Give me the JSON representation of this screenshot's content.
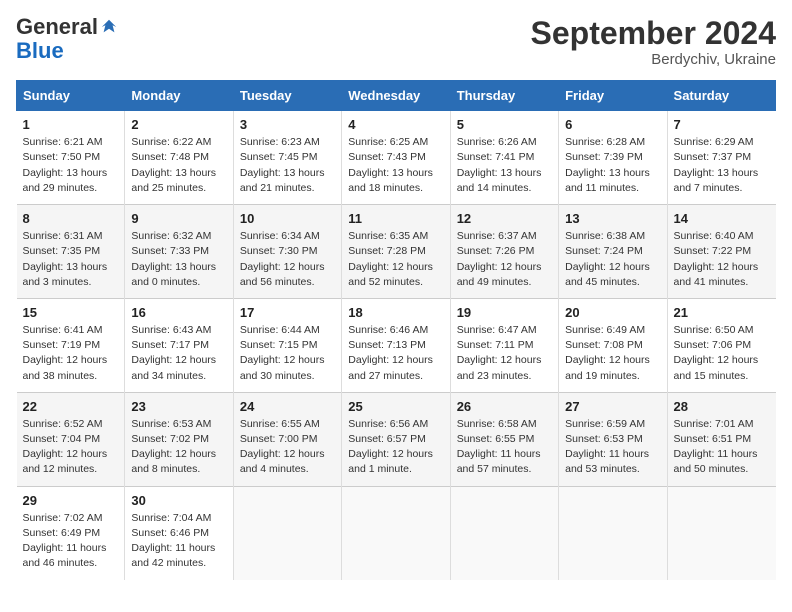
{
  "logo": {
    "general": "General",
    "blue": "Blue"
  },
  "header": {
    "title": "September 2024",
    "subtitle": "Berdychiv, Ukraine"
  },
  "days_of_week": [
    "Sunday",
    "Monday",
    "Tuesday",
    "Wednesday",
    "Thursday",
    "Friday",
    "Saturday"
  ],
  "weeks": [
    [
      {
        "num": "1",
        "rise": "Sunrise: 6:21 AM",
        "set": "Sunset: 7:50 PM",
        "daylight": "Daylight: 13 hours and 29 minutes."
      },
      {
        "num": "2",
        "rise": "Sunrise: 6:22 AM",
        "set": "Sunset: 7:48 PM",
        "daylight": "Daylight: 13 hours and 25 minutes."
      },
      {
        "num": "3",
        "rise": "Sunrise: 6:23 AM",
        "set": "Sunset: 7:45 PM",
        "daylight": "Daylight: 13 hours and 21 minutes."
      },
      {
        "num": "4",
        "rise": "Sunrise: 6:25 AM",
        "set": "Sunset: 7:43 PM",
        "daylight": "Daylight: 13 hours and 18 minutes."
      },
      {
        "num": "5",
        "rise": "Sunrise: 6:26 AM",
        "set": "Sunset: 7:41 PM",
        "daylight": "Daylight: 13 hours and 14 minutes."
      },
      {
        "num": "6",
        "rise": "Sunrise: 6:28 AM",
        "set": "Sunset: 7:39 PM",
        "daylight": "Daylight: 13 hours and 11 minutes."
      },
      {
        "num": "7",
        "rise": "Sunrise: 6:29 AM",
        "set": "Sunset: 7:37 PM",
        "daylight": "Daylight: 13 hours and 7 minutes."
      }
    ],
    [
      {
        "num": "8",
        "rise": "Sunrise: 6:31 AM",
        "set": "Sunset: 7:35 PM",
        "daylight": "Daylight: 13 hours and 3 minutes."
      },
      {
        "num": "9",
        "rise": "Sunrise: 6:32 AM",
        "set": "Sunset: 7:33 PM",
        "daylight": "Daylight: 13 hours and 0 minutes."
      },
      {
        "num": "10",
        "rise": "Sunrise: 6:34 AM",
        "set": "Sunset: 7:30 PM",
        "daylight": "Daylight: 12 hours and 56 minutes."
      },
      {
        "num": "11",
        "rise": "Sunrise: 6:35 AM",
        "set": "Sunset: 7:28 PM",
        "daylight": "Daylight: 12 hours and 52 minutes."
      },
      {
        "num": "12",
        "rise": "Sunrise: 6:37 AM",
        "set": "Sunset: 7:26 PM",
        "daylight": "Daylight: 12 hours and 49 minutes."
      },
      {
        "num": "13",
        "rise": "Sunrise: 6:38 AM",
        "set": "Sunset: 7:24 PM",
        "daylight": "Daylight: 12 hours and 45 minutes."
      },
      {
        "num": "14",
        "rise": "Sunrise: 6:40 AM",
        "set": "Sunset: 7:22 PM",
        "daylight": "Daylight: 12 hours and 41 minutes."
      }
    ],
    [
      {
        "num": "15",
        "rise": "Sunrise: 6:41 AM",
        "set": "Sunset: 7:19 PM",
        "daylight": "Daylight: 12 hours and 38 minutes."
      },
      {
        "num": "16",
        "rise": "Sunrise: 6:43 AM",
        "set": "Sunset: 7:17 PM",
        "daylight": "Daylight: 12 hours and 34 minutes."
      },
      {
        "num": "17",
        "rise": "Sunrise: 6:44 AM",
        "set": "Sunset: 7:15 PM",
        "daylight": "Daylight: 12 hours and 30 minutes."
      },
      {
        "num": "18",
        "rise": "Sunrise: 6:46 AM",
        "set": "Sunset: 7:13 PM",
        "daylight": "Daylight: 12 hours and 27 minutes."
      },
      {
        "num": "19",
        "rise": "Sunrise: 6:47 AM",
        "set": "Sunset: 7:11 PM",
        "daylight": "Daylight: 12 hours and 23 minutes."
      },
      {
        "num": "20",
        "rise": "Sunrise: 6:49 AM",
        "set": "Sunset: 7:08 PM",
        "daylight": "Daylight: 12 hours and 19 minutes."
      },
      {
        "num": "21",
        "rise": "Sunrise: 6:50 AM",
        "set": "Sunset: 7:06 PM",
        "daylight": "Daylight: 12 hours and 15 minutes."
      }
    ],
    [
      {
        "num": "22",
        "rise": "Sunrise: 6:52 AM",
        "set": "Sunset: 7:04 PM",
        "daylight": "Daylight: 12 hours and 12 minutes."
      },
      {
        "num": "23",
        "rise": "Sunrise: 6:53 AM",
        "set": "Sunset: 7:02 PM",
        "daylight": "Daylight: 12 hours and 8 minutes."
      },
      {
        "num": "24",
        "rise": "Sunrise: 6:55 AM",
        "set": "Sunset: 7:00 PM",
        "daylight": "Daylight: 12 hours and 4 minutes."
      },
      {
        "num": "25",
        "rise": "Sunrise: 6:56 AM",
        "set": "Sunset: 6:57 PM",
        "daylight": "Daylight: 12 hours and 1 minute."
      },
      {
        "num": "26",
        "rise": "Sunrise: 6:58 AM",
        "set": "Sunset: 6:55 PM",
        "daylight": "Daylight: 11 hours and 57 minutes."
      },
      {
        "num": "27",
        "rise": "Sunrise: 6:59 AM",
        "set": "Sunset: 6:53 PM",
        "daylight": "Daylight: 11 hours and 53 minutes."
      },
      {
        "num": "28",
        "rise": "Sunrise: 7:01 AM",
        "set": "Sunset: 6:51 PM",
        "daylight": "Daylight: 11 hours and 50 minutes."
      }
    ],
    [
      {
        "num": "29",
        "rise": "Sunrise: 7:02 AM",
        "set": "Sunset: 6:49 PM",
        "daylight": "Daylight: 11 hours and 46 minutes."
      },
      {
        "num": "30",
        "rise": "Sunrise: 7:04 AM",
        "set": "Sunset: 6:46 PM",
        "daylight": "Daylight: 11 hours and 42 minutes."
      },
      {
        "num": "",
        "rise": "",
        "set": "",
        "daylight": ""
      },
      {
        "num": "",
        "rise": "",
        "set": "",
        "daylight": ""
      },
      {
        "num": "",
        "rise": "",
        "set": "",
        "daylight": ""
      },
      {
        "num": "",
        "rise": "",
        "set": "",
        "daylight": ""
      },
      {
        "num": "",
        "rise": "",
        "set": "",
        "daylight": ""
      }
    ]
  ]
}
